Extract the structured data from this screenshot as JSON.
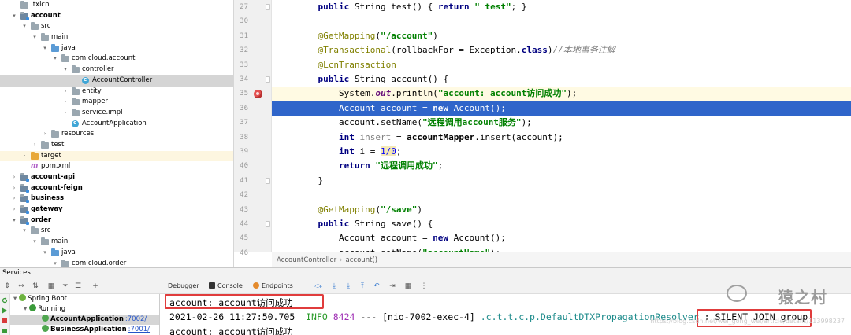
{
  "tree": [
    {
      "label": ".txlcn",
      "depth": 0,
      "arrow": "",
      "icon": "folder",
      "bold": false
    },
    {
      "label": "account",
      "depth": 0,
      "arrow": "down",
      "icon": "mod",
      "bold": true
    },
    {
      "label": "src",
      "depth": 1,
      "arrow": "down",
      "icon": "folder",
      "bold": false
    },
    {
      "label": "main",
      "depth": 2,
      "arrow": "down",
      "icon": "folder",
      "bold": false
    },
    {
      "label": "java",
      "depth": 3,
      "arrow": "down",
      "icon": "folder-blue",
      "bold": false
    },
    {
      "label": "com.cloud.account",
      "depth": 4,
      "arrow": "down",
      "icon": "folder",
      "bold": false
    },
    {
      "label": "controller",
      "depth": 5,
      "arrow": "down",
      "icon": "folder",
      "bold": false
    },
    {
      "label": "AccountController",
      "depth": 6,
      "arrow": "",
      "icon": "class",
      "bold": false,
      "selected": true
    },
    {
      "label": "entity",
      "depth": 5,
      "arrow": "right",
      "icon": "folder",
      "bold": false
    },
    {
      "label": "mapper",
      "depth": 5,
      "arrow": "right",
      "icon": "folder",
      "bold": false
    },
    {
      "label": "service.impl",
      "depth": 5,
      "arrow": "right",
      "icon": "folder",
      "bold": false
    },
    {
      "label": "AccountApplication",
      "depth": 5,
      "arrow": "",
      "icon": "class",
      "bold": false
    },
    {
      "label": "resources",
      "depth": 3,
      "arrow": "right",
      "icon": "folder",
      "bold": false
    },
    {
      "label": "test",
      "depth": 2,
      "arrow": "right",
      "icon": "folder",
      "bold": false
    },
    {
      "label": "target",
      "depth": 1,
      "arrow": "right",
      "icon": "folder-orange",
      "bold": false,
      "highlight": true
    },
    {
      "label": "pom.xml",
      "depth": 1,
      "arrow": "",
      "icon": "pom",
      "bold": false
    },
    {
      "label": "account-api",
      "depth": 0,
      "arrow": "right",
      "icon": "mod",
      "bold": true
    },
    {
      "label": "account-feign",
      "depth": 0,
      "arrow": "right",
      "icon": "mod",
      "bold": true
    },
    {
      "label": "business",
      "depth": 0,
      "arrow": "right",
      "icon": "mod",
      "bold": true
    },
    {
      "label": "gateway",
      "depth": 0,
      "arrow": "right",
      "icon": "mod",
      "bold": true
    },
    {
      "label": "order",
      "depth": 0,
      "arrow": "down",
      "icon": "mod",
      "bold": true
    },
    {
      "label": "src",
      "depth": 1,
      "arrow": "down",
      "icon": "folder",
      "bold": false
    },
    {
      "label": "main",
      "depth": 2,
      "arrow": "down",
      "icon": "folder",
      "bold": false
    },
    {
      "label": "java",
      "depth": 3,
      "arrow": "down",
      "icon": "folder-blue",
      "bold": false
    },
    {
      "label": "com.cloud.order",
      "depth": 4,
      "arrow": "down",
      "icon": "folder",
      "bold": false
    }
  ],
  "editor": {
    "line_numbers": [
      "27",
      "30",
      "31",
      "32",
      "33",
      "34",
      "35",
      "36",
      "37",
      "38",
      "39",
      "40",
      "41",
      "42",
      "43",
      "44",
      "45",
      "46"
    ],
    "lines": [
      [
        [
          "    ",
          ""
        ],
        [
          "public",
          "kw"
        ],
        [
          " String test() ",
          ""
        ],
        [
          "{",
          ""
        ],
        [
          " ",
          ""
        ],
        [
          "return",
          "kw"
        ],
        [
          " ",
          ""
        ],
        [
          "\" test\"",
          "str"
        ],
        [
          "; }",
          ""
        ]
      ],
      [
        [
          "",
          ""
        ]
      ],
      [
        [
          "    ",
          ""
        ],
        [
          "@GetMapping",
          "ann"
        ],
        [
          "(",
          ""
        ],
        [
          "\"/account\"",
          "str"
        ],
        [
          ")",
          ""
        ]
      ],
      [
        [
          "    ",
          ""
        ],
        [
          "@Transactional",
          "ann"
        ],
        [
          "(rollbackFor = Exception.",
          ""
        ],
        [
          "class",
          "kw"
        ],
        [
          ")",
          ""
        ],
        [
          "//本地事务注解",
          "cmt"
        ]
      ],
      [
        [
          "    ",
          ""
        ],
        [
          "@LcnTransaction",
          "ann"
        ]
      ],
      [
        [
          "    ",
          ""
        ],
        [
          "public",
          "kw"
        ],
        [
          " String account() {",
          ""
        ]
      ],
      [
        [
          "        System.",
          ""
        ],
        [
          "out",
          "fld"
        ],
        [
          ".println(",
          ""
        ],
        [
          "\"account: account访问成功\"",
          "str"
        ],
        [
          ");",
          ""
        ]
      ],
      [
        [
          "        Account account = ",
          ""
        ],
        [
          "new",
          "kw"
        ],
        [
          " Account();",
          ""
        ]
      ],
      [
        [
          "        account.setName(",
          ""
        ],
        [
          "\"远程调用account服务\"",
          "str"
        ],
        [
          ");",
          ""
        ]
      ],
      [
        [
          "        ",
          ""
        ],
        [
          "int",
          "kw"
        ],
        [
          " ",
          ""
        ],
        [
          "insert",
          "unused"
        ],
        [
          " = ",
          ""
        ],
        [
          "accountMapper",
          "fldn"
        ],
        [
          ".insert(account);",
          ""
        ]
      ],
      [
        [
          "        ",
          ""
        ],
        [
          "int",
          "kw"
        ],
        [
          " i = ",
          ""
        ],
        [
          "1/0",
          "num"
        ],
        [
          ";",
          ""
        ]
      ],
      [
        [
          "        ",
          ""
        ],
        [
          "return",
          "kw"
        ],
        [
          " ",
          ""
        ],
        [
          "\"远程调用成功\"",
          "str"
        ],
        [
          ";",
          ""
        ]
      ],
      [
        [
          "    }",
          ""
        ]
      ],
      [
        [
          "",
          ""
        ]
      ],
      [
        [
          "    ",
          ""
        ],
        [
          "@GetMapping",
          "ann"
        ],
        [
          "(",
          ""
        ],
        [
          "\"/save\"",
          "str"
        ],
        [
          ")",
          ""
        ]
      ],
      [
        [
          "    ",
          ""
        ],
        [
          "public",
          "kw"
        ],
        [
          " String save() {",
          ""
        ]
      ],
      [
        [
          "        Account account = ",
          ""
        ],
        [
          "new",
          "kw"
        ],
        [
          " Account();",
          ""
        ]
      ],
      [
        [
          "        account.setName(",
          ""
        ],
        [
          "\"accountName\"",
          "str"
        ],
        [
          ");",
          ""
        ]
      ]
    ],
    "breadcrumb": [
      "AccountController",
      "account()"
    ]
  },
  "services": {
    "title": "Services",
    "tree": [
      {
        "label": "Spring Boot",
        "depth": 0,
        "arrow": "down"
      },
      {
        "label": "Running",
        "depth": 1,
        "arrow": "down"
      },
      {
        "label": "AccountApplication",
        "port": ":7002/",
        "depth": 2,
        "selected": true
      },
      {
        "label": "BusinessApplication",
        "port": ":7001/",
        "depth": 2
      }
    ],
    "tabs": [
      "Debugger",
      "Console",
      "Endpoints"
    ]
  },
  "console": {
    "line1": "account: account访问成功",
    "line2_time": "2021-02-26 11:27:50.705",
    "line2_level": "INFO",
    "line2_pid": "8424",
    "line2_sep": "---",
    "line2_thread": "[nio-7002-exec-4]",
    "line2_logger": ".c.t.t.c.p.DefaultDTXPropagationResolver",
    "line2_colon": ":",
    "line2_msg": "SILENT_JOIN group!",
    "line3": "account: account访问成功"
  },
  "watermark": {
    "text": "猿之村",
    "url": "https://blog.csdn.net/wei_gong_wei/article/details/113998237"
  },
  "colors": {
    "selection": "#2f65ca",
    "red_box": "#e03c3c",
    "keyword": "#000080",
    "string": "#008000"
  }
}
